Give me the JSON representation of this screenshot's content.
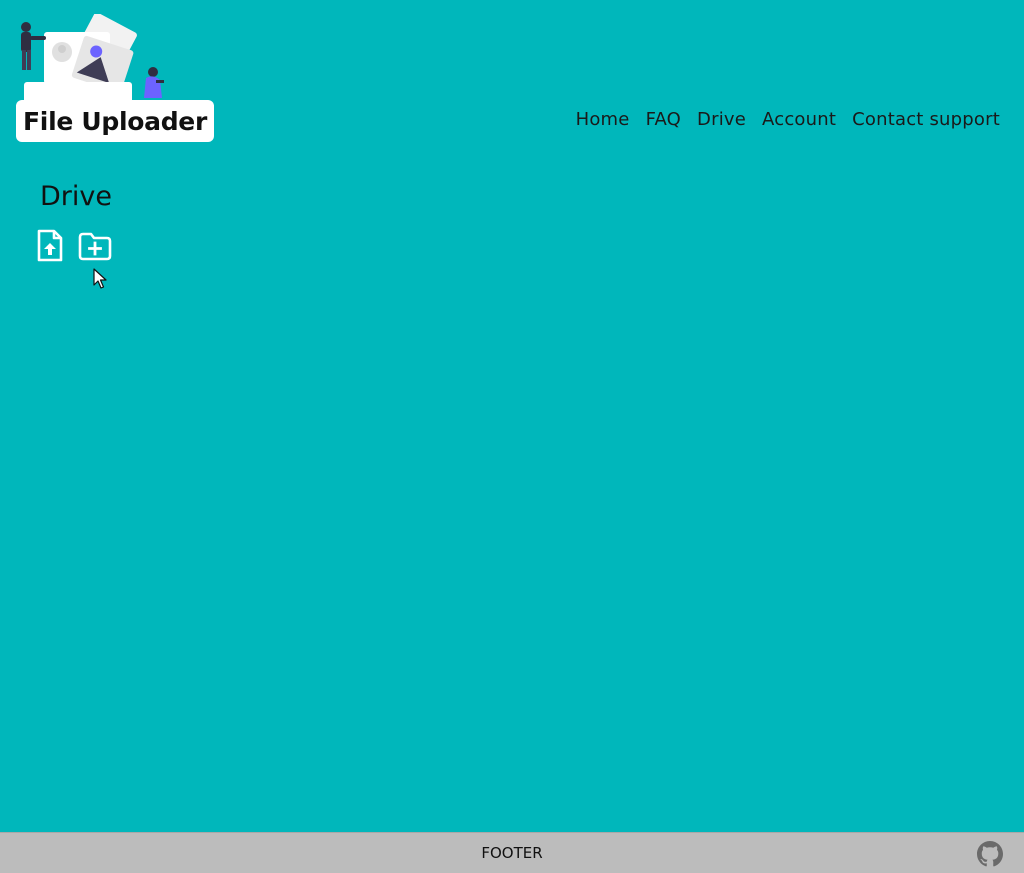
{
  "header": {
    "logo_text": "File Uploader",
    "nav": {
      "home": "Home",
      "faq": "FAQ",
      "drive": "Drive",
      "account": "Account",
      "contact": "Contact support"
    }
  },
  "main": {
    "title": "Drive",
    "actions": {
      "upload_icon": "file-upload-icon",
      "new_folder_icon": "folder-plus-icon"
    }
  },
  "footer": {
    "text": "FOOTER",
    "github_icon": "github-icon"
  },
  "colors": {
    "background": "#00b7bb",
    "footer": "#bcbcbc",
    "logo_box": "#ffffff",
    "icon": "#ffffff",
    "accent_figure": "#6c63ff"
  }
}
